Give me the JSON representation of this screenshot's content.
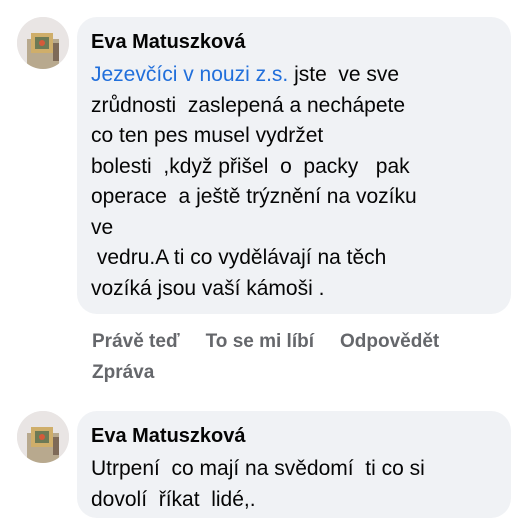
{
  "comments": [
    {
      "author": "Eva Matuszková",
      "mention": "Jezevčíci v nouzi z.s.",
      "lines": [
        " jste  ve sve",
        "zrůdnosti  zaslepená a nechápete",
        "co ten pes musel vydržet",
        "bolesti  ,když přišel  o  packy   pak",
        "operace  a ještě trýznění na vozíku",
        "ve",
        " vedru.A ti co vydělávají na těch",
        "vozíká jsou vaší kámoši ."
      ],
      "actions": {
        "time": "Právě teď",
        "like": "To se mi líbí",
        "reply": "Odpovědět",
        "message": "Zpráva"
      }
    },
    {
      "author": "Eva Matuszková",
      "lines": [
        "Utrpení  co mají na svědomí  ti co si",
        "dovolí  říkat  lidé,."
      ]
    }
  ],
  "icons": {
    "avatar": "profile-photo-avatar"
  },
  "colors": {
    "bubble": "#f0f2f5",
    "mention": "#216fdb",
    "meta": "#65676b"
  }
}
